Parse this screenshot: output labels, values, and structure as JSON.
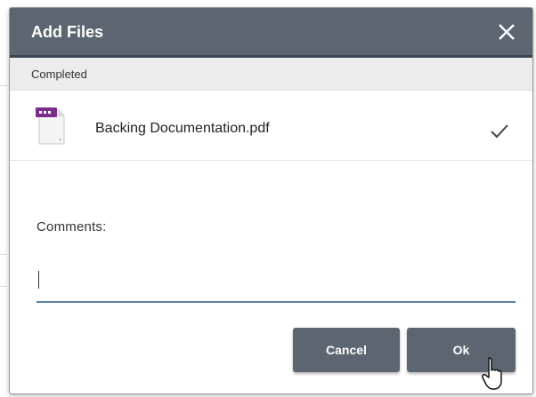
{
  "dialog": {
    "title": "Add Files",
    "close_icon": "close-icon"
  },
  "section": {
    "label": "Completed"
  },
  "files": [
    {
      "name": "Backing Documentation.pdf",
      "icon": "pdf-file-icon",
      "status_icon": "checkmark-icon"
    }
  ],
  "comments": {
    "label": "Comments:",
    "value": ""
  },
  "buttons": {
    "cancel": "Cancel",
    "ok": "Ok"
  },
  "colors": {
    "titlebar": "#5d6570",
    "button": "#5d6570",
    "input_underline": "#5c7fa3",
    "pdf_badge": "#7b2d8b"
  }
}
